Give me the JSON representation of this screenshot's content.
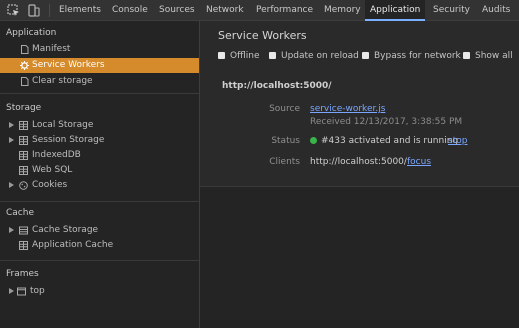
{
  "toolbar": {
    "tabs": [
      "Elements",
      "Console",
      "Sources",
      "Network",
      "Performance",
      "Memory",
      "Application",
      "Security",
      "Audits"
    ],
    "active_tab": "Application"
  },
  "sidebar": {
    "application": {
      "title": "Application",
      "items": [
        "Manifest",
        "Service Workers",
        "Clear storage"
      ]
    },
    "storage": {
      "title": "Storage",
      "items": [
        "Local Storage",
        "Session Storage",
        "IndexedDB",
        "Web SQL",
        "Cookies"
      ]
    },
    "cache": {
      "title": "Cache",
      "items": [
        "Cache Storage",
        "Application Cache"
      ]
    },
    "frames": {
      "title": "Frames",
      "items": [
        "top"
      ]
    }
  },
  "main": {
    "title": "Service Workers",
    "options": [
      "Offline",
      "Update on reload",
      "Bypass for network",
      "Show all"
    ],
    "origin": "http://localhost:5000/",
    "source_label": "Source",
    "source_link": "service-worker.js",
    "received": "Received 12/13/2017, 3:38:55 PM",
    "status_label": "Status",
    "status_text": "#433 activated and is running",
    "status_action": "stop",
    "clients_label": "Clients",
    "clients_value": "http://localhost:5000/",
    "clients_action": "focus"
  },
  "colors": {
    "selected_bg": "#d58a2b",
    "link": "#7aa6ff",
    "status_dot": "#38b449"
  }
}
